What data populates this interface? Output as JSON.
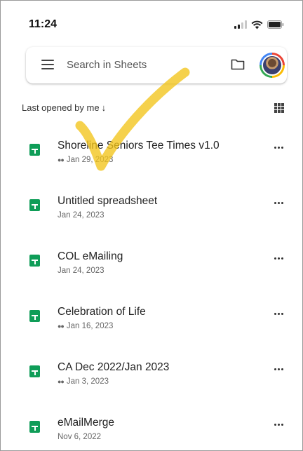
{
  "status_bar": {
    "time": "11:24",
    "icons": [
      "signal-icon",
      "wifi-icon",
      "battery-icon"
    ]
  },
  "search": {
    "placeholder": "Search in Sheets",
    "icons": [
      "menu-icon",
      "folder-icon",
      "avatar"
    ]
  },
  "sort": {
    "label": "Last opened by me",
    "arrow": "↓",
    "view_icon": "grid-view-icon"
  },
  "files": [
    {
      "name": "Shoreline Seniors Tee Times v1.0",
      "date": "Jan 29, 2023",
      "shared": true
    },
    {
      "name": "Untitled spreadsheet",
      "date": "Jan 24, 2023",
      "shared": false
    },
    {
      "name": "COL eMailing",
      "date": "Jan 24, 2023",
      "shared": false
    },
    {
      "name": "Celebration of Life",
      "date": "Jan 16, 2023",
      "shared": true
    },
    {
      "name": "CA Dec 2022/Jan 2023",
      "date": "Jan 3, 2023",
      "shared": true
    },
    {
      "name": "eMailMerge",
      "date": "Nov 6, 2022",
      "shared": false
    }
  ],
  "colors": {
    "sheets_green": "#0f9d58",
    "annotation_yellow": "#f2c419"
  }
}
